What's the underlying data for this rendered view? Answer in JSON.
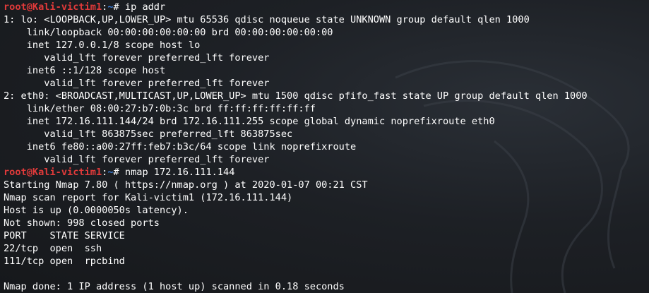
{
  "prompt": {
    "user_host": "root@Kali-victim1",
    "separator": ":",
    "path": "~",
    "symbol": "# "
  },
  "commands": [
    "ip addr",
    "nmap 172.16.111.144"
  ],
  "lines": [
    {
      "type": "prompt",
      "command": "ip addr"
    },
    {
      "type": "output",
      "text": "1: lo: <LOOPBACK,UP,LOWER_UP> mtu 65536 qdisc noqueue state UNKNOWN group default qlen 1000"
    },
    {
      "type": "output",
      "text": "    link/loopback 00:00:00:00:00:00 brd 00:00:00:00:00:00"
    },
    {
      "type": "output",
      "text": "    inet 127.0.0.1/8 scope host lo"
    },
    {
      "type": "output",
      "text": "       valid_lft forever preferred_lft forever"
    },
    {
      "type": "output",
      "text": "    inet6 ::1/128 scope host"
    },
    {
      "type": "output",
      "text": "       valid_lft forever preferred_lft forever"
    },
    {
      "type": "output",
      "text": "2: eth0: <BROADCAST,MULTICAST,UP,LOWER_UP> mtu 1500 qdisc pfifo_fast state UP group default qlen 1000"
    },
    {
      "type": "output",
      "text": "    link/ether 08:00:27:b7:0b:3c brd ff:ff:ff:ff:ff:ff"
    },
    {
      "type": "output",
      "text": "    inet 172.16.111.144/24 brd 172.16.111.255 scope global dynamic noprefixroute eth0"
    },
    {
      "type": "output",
      "text": "       valid_lft 863875sec preferred_lft 863875sec"
    },
    {
      "type": "output",
      "text": "    inet6 fe80::a00:27ff:feb7:b3c/64 scope link noprefixroute"
    },
    {
      "type": "output",
      "text": "       valid_lft forever preferred_lft forever"
    },
    {
      "type": "prompt",
      "command": "nmap 172.16.111.144"
    },
    {
      "type": "output",
      "text": "Starting Nmap 7.80 ( https://nmap.org ) at 2020-01-07 00:21 CST"
    },
    {
      "type": "output",
      "text": "Nmap scan report for Kali-victim1 (172.16.111.144)"
    },
    {
      "type": "output",
      "text": "Host is up (0.0000050s latency)."
    },
    {
      "type": "output",
      "text": "Not shown: 998 closed ports"
    },
    {
      "type": "output",
      "text": "PORT    STATE SERVICE"
    },
    {
      "type": "output",
      "text": "22/tcp  open  ssh"
    },
    {
      "type": "output",
      "text": "111/tcp open  rpcbind"
    },
    {
      "type": "output",
      "text": ""
    },
    {
      "type": "output",
      "text": "Nmap done: 1 IP address (1 host up) scanned in 0.18 seconds"
    }
  ],
  "colors": {
    "background": "#1b1d21",
    "prompt_user": "#e03a3a",
    "prompt_path": "#3b7dd8",
    "text": "#ffffff"
  },
  "icons": {
    "wallpaper": "kali-dragon-outline"
  }
}
